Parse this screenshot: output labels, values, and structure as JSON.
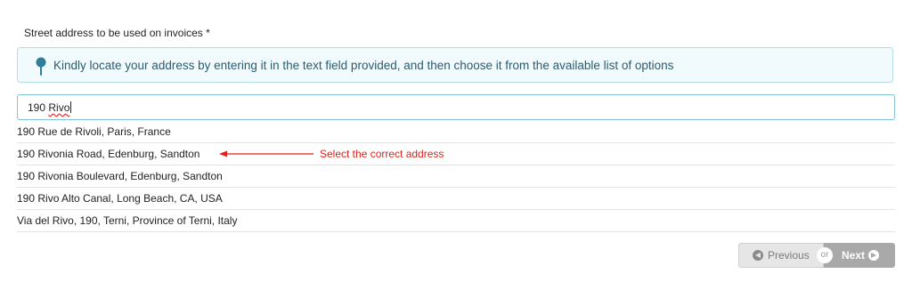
{
  "form": {
    "label": "Street address to be used on invoices *",
    "info": {
      "icon": "map-pin-icon",
      "text": "Kindly locate your address by entering it in the text field provided, and then choose it from the available list of options"
    },
    "input": {
      "value": "190 Rivo",
      "value_prefix": "190 ",
      "value_misspelled": "Rivo"
    },
    "suggestions": [
      "190 Rue de Rivoli, Paris, France",
      "190 Rivonia Road, Edenburg, Sandton",
      "190 Rivonia Boulevard, Edenburg, Sandton",
      "190 Rivo Alto Canal, Long Beach, CA, USA",
      "Via del Rivo, 190, Terni, Province of Terni, Italy"
    ],
    "annotation": {
      "text": "Select the correct address",
      "color": "#e0201a"
    }
  },
  "navigation": {
    "previous_label": "Previous",
    "or_label": "or",
    "next_label": "Next",
    "previous_icon": "chevron-left-circle-icon",
    "next_icon": "chevron-right-circle-icon"
  }
}
